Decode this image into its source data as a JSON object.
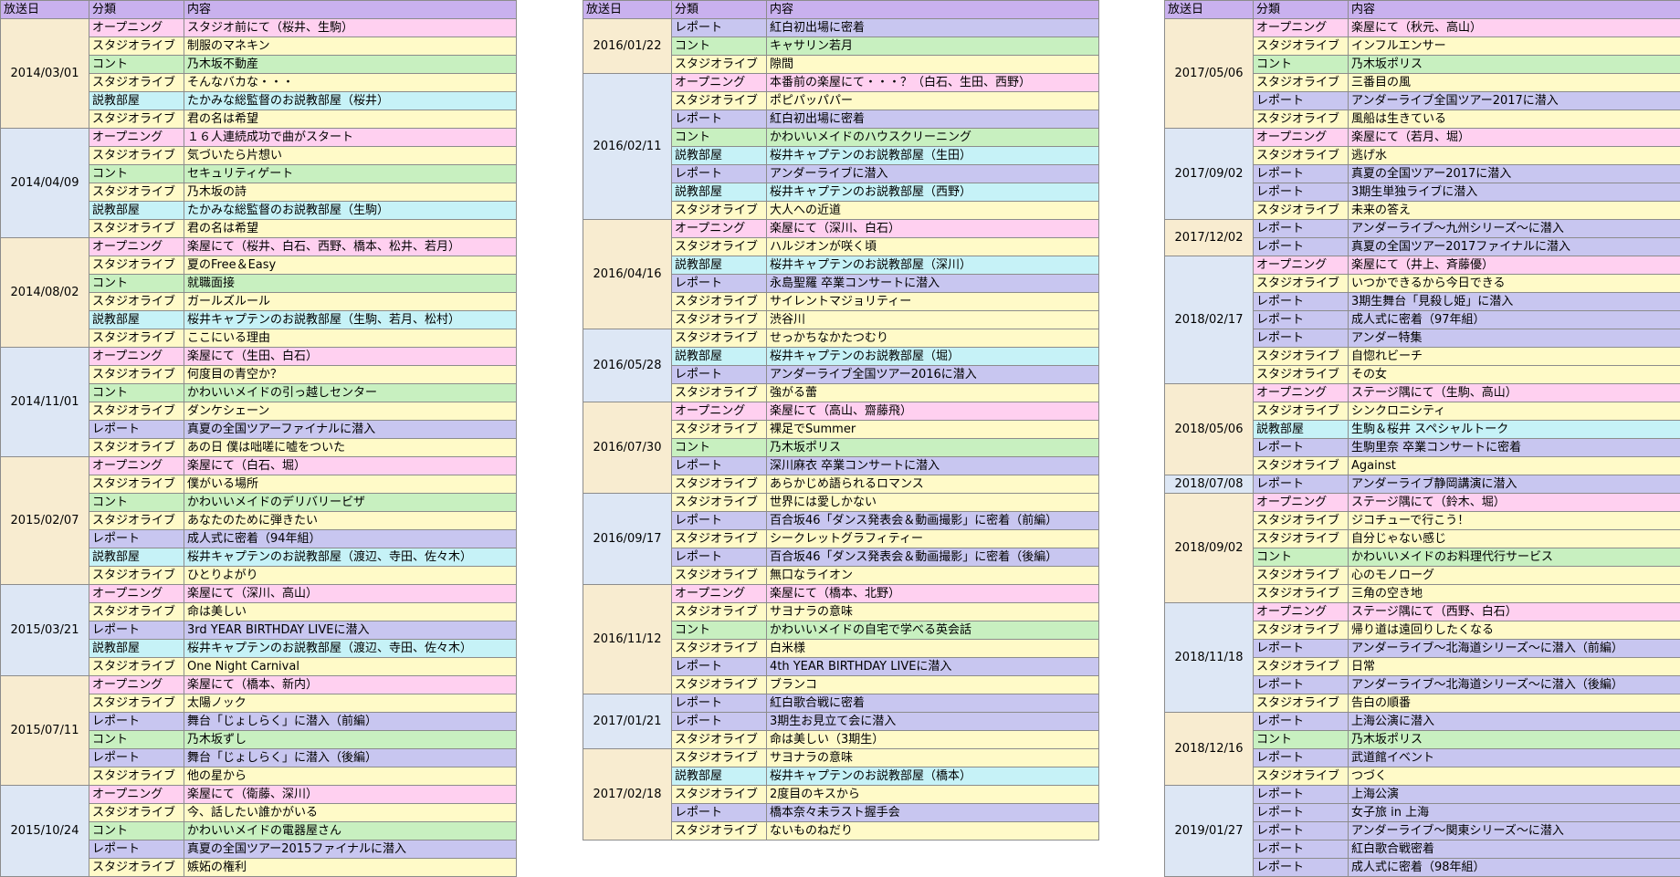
{
  "header": {
    "date": "放送日",
    "category": "分類",
    "content": "内容"
  },
  "colors": {
    "header": "#c9b1ee",
    "オープニング": "#ffd0f0",
    "スタジオライブ": "#fffac8",
    "コント": "#c8f0c0",
    "レポート": "#c8c6f0",
    "説教部屋": "#c6f2f7",
    "date_blue": "#dde7f5",
    "date_tan": "#f8ecd0"
  },
  "tables": [
    {
      "groups": [
        {
          "date": "2014/03/01",
          "rows": [
            {
              "cat": "オープニング",
              "text": "スタジオ前にて（桜井、生駒）"
            },
            {
              "cat": "スタジオライブ",
              "text": "制服のマネキン"
            },
            {
              "cat": "コント",
              "text": "乃木坂不動産"
            },
            {
              "cat": "スタジオライブ",
              "text": "そんなバカな・・・"
            },
            {
              "cat": "説教部屋",
              "text": "たかみな総監督のお説教部屋（桜井）"
            },
            {
              "cat": "スタジオライブ",
              "text": "君の名は希望"
            }
          ]
        },
        {
          "date": "2014/04/09",
          "rows": [
            {
              "cat": "オープニング",
              "text": "１６人連続成功で曲がスタート"
            },
            {
              "cat": "スタジオライブ",
              "text": "気づいたら片想い"
            },
            {
              "cat": "コント",
              "text": "セキュリティゲート"
            },
            {
              "cat": "スタジオライブ",
              "text": "乃木坂の詩"
            },
            {
              "cat": "説教部屋",
              "text": "たかみな総監督のお説教部屋（生駒）"
            },
            {
              "cat": "スタジオライブ",
              "text": "君の名は希望"
            }
          ]
        },
        {
          "date": "2014/08/02",
          "rows": [
            {
              "cat": "オープニング",
              "text": "楽屋にて（桜井、白石、西野、橋本、松井、若月）"
            },
            {
              "cat": "スタジオライブ",
              "text": "夏のFree＆Easy"
            },
            {
              "cat": "コント",
              "text": "就職面接"
            },
            {
              "cat": "スタジオライブ",
              "text": "ガールズルール"
            },
            {
              "cat": "説教部屋",
              "text": "桜井キャプテンのお説教部屋（生駒、若月、松村）"
            },
            {
              "cat": "スタジオライブ",
              "text": "ここにいる理由"
            }
          ]
        },
        {
          "date": "2014/11/01",
          "rows": [
            {
              "cat": "オープニング",
              "text": "楽屋にて（生田、白石）"
            },
            {
              "cat": "スタジオライブ",
              "text": "何度目の青空か？"
            },
            {
              "cat": "コント",
              "text": "かわいいメイドの引っ越しセンター"
            },
            {
              "cat": "スタジオライブ",
              "text": "ダンケシェーン"
            },
            {
              "cat": "レポート",
              "text": "真夏の全国ツアーファイナルに潜入"
            },
            {
              "cat": "スタジオライブ",
              "text": "あの日 僕は咄嗟に嘘をついた"
            }
          ]
        },
        {
          "date": "2015/02/07",
          "rows": [
            {
              "cat": "オープニング",
              "text": "楽屋にて（白石、堀）"
            },
            {
              "cat": "スタジオライブ",
              "text": "僕がいる場所"
            },
            {
              "cat": "コント",
              "text": "かわいいメイドのデリバリービザ"
            },
            {
              "cat": "スタジオライブ",
              "text": "あなたのために弾きたい"
            },
            {
              "cat": "レポート",
              "text": "成人式に密着（94年組）"
            },
            {
              "cat": "説教部屋",
              "text": "桜井キャプテンのお説教部屋（渡辺、寺田、佐々木）"
            },
            {
              "cat": "スタジオライブ",
              "text": "ひとりよがり"
            }
          ]
        },
        {
          "date": "2015/03/21",
          "rows": [
            {
              "cat": "オープニング",
              "text": "楽屋にて（深川、高山）"
            },
            {
              "cat": "スタジオライブ",
              "text": "命は美しい"
            },
            {
              "cat": "レポート",
              "text": "3rd YEAR BIRTHDAY LIVEに潜入"
            },
            {
              "cat": "説教部屋",
              "text": "桜井キャプテンのお説教部屋（渡辺、寺田、佐々木）"
            },
            {
              "cat": "スタジオライブ",
              "text": "One Night Carnival"
            }
          ]
        },
        {
          "date": "2015/07/11",
          "rows": [
            {
              "cat": "オープニング",
              "text": "楽屋にて（橋本、新内）"
            },
            {
              "cat": "スタジオライブ",
              "text": "太陽ノック"
            },
            {
              "cat": "レポート",
              "text": "舞台「じょしらく」に潜入（前編）"
            },
            {
              "cat": "コント",
              "text": "乃木坂ずし"
            },
            {
              "cat": "レポート",
              "text": "舞台「じょしらく」に潜入（後編）"
            },
            {
              "cat": "スタジオライブ",
              "text": "他の星から"
            }
          ]
        },
        {
          "date": "2015/10/24",
          "rows": [
            {
              "cat": "オープニング",
              "text": "楽屋にて（衛藤、深川）"
            },
            {
              "cat": "スタジオライブ",
              "text": "今、話したい誰かがいる"
            },
            {
              "cat": "コント",
              "text": "かわいいメイドの電器屋さん"
            },
            {
              "cat": "レポート",
              "text": "真夏の全国ツアー2015ファイナルに潜入"
            },
            {
              "cat": "スタジオライブ",
              "text": "嫉妬の権利"
            }
          ]
        }
      ]
    },
    {
      "groups": [
        {
          "date": "2016/01/22",
          "rows": [
            {
              "cat": "レポート",
              "text": "紅白初出場に密着"
            },
            {
              "cat": "コント",
              "text": "キャサリン若月"
            },
            {
              "cat": "スタジオライブ",
              "text": "隙間"
            }
          ]
        },
        {
          "date": "2016/02/11",
          "rows": [
            {
              "cat": "オープニング",
              "text": "本番前の楽屋にて・・・？（白石、生田、西野）"
            },
            {
              "cat": "スタジオライブ",
              "text": "ポピパッパパー"
            },
            {
              "cat": "レポート",
              "text": "紅白初出場に密着"
            },
            {
              "cat": "コント",
              "text": "かわいいメイドのハウスクリーニング"
            },
            {
              "cat": "説教部屋",
              "text": "桜井キャプテンのお説教部屋（生田）"
            },
            {
              "cat": "レポート",
              "text": "アンダーライブに潜入"
            },
            {
              "cat": "説教部屋",
              "text": "桜井キャプテンのお説教部屋（西野）"
            },
            {
              "cat": "スタジオライブ",
              "text": "大人への近道"
            }
          ]
        },
        {
          "date": "2016/04/16",
          "rows": [
            {
              "cat": "オープニング",
              "text": "楽屋にて（深川、白石）"
            },
            {
              "cat": "スタジオライブ",
              "text": "ハルジオンが咲く頃"
            },
            {
              "cat": "説教部屋",
              "text": "桜井キャプテンのお説教部屋（深川）"
            },
            {
              "cat": "レポート",
              "text": "永島聖羅 卒業コンサートに潜入"
            },
            {
              "cat": "スタジオライブ",
              "text": "サイレントマジョリティー"
            },
            {
              "cat": "スタジオライブ",
              "text": "渋谷川"
            }
          ]
        },
        {
          "date": "2016/05/28",
          "rows": [
            {
              "cat": "スタジオライブ",
              "text": "せっかちなかたつむり"
            },
            {
              "cat": "説教部屋",
              "text": "桜井キャプテンのお説教部屋（堀）"
            },
            {
              "cat": "レポート",
              "text": "アンダーライブ全国ツアー2016に潜入"
            },
            {
              "cat": "スタジオライブ",
              "text": "強がる蕾"
            }
          ]
        },
        {
          "date": "2016/07/30",
          "rows": [
            {
              "cat": "オープニング",
              "text": "楽屋にて（高山、齋藤飛）"
            },
            {
              "cat": "スタジオライブ",
              "text": "裸足でSummer"
            },
            {
              "cat": "コント",
              "text": "乃木坂ポリス"
            },
            {
              "cat": "レポート",
              "text": "深川麻衣 卒業コンサートに潜入"
            },
            {
              "cat": "スタジオライブ",
              "text": "あらかじめ語られるロマンス"
            }
          ]
        },
        {
          "date": "2016/09/17",
          "rows": [
            {
              "cat": "スタジオライブ",
              "text": "世界には愛しかない"
            },
            {
              "cat": "レポート",
              "text": "百合坂46「ダンス発表会＆動画撮影」に密着（前編）"
            },
            {
              "cat": "スタジオライブ",
              "text": "シークレットグラフィティー"
            },
            {
              "cat": "レポート",
              "text": "百合坂46「ダンス発表会＆動画撮影」に密着（後編）"
            },
            {
              "cat": "スタジオライブ",
              "text": "無口なライオン"
            }
          ]
        },
        {
          "date": "2016/11/12",
          "rows": [
            {
              "cat": "オープニング",
              "text": "楽屋にて（橋本、北野）"
            },
            {
              "cat": "スタジオライブ",
              "text": "サヨナラの意味"
            },
            {
              "cat": "コント",
              "text": "かわいいメイドの自宅で学べる英会話"
            },
            {
              "cat": "スタジオライブ",
              "text": "白米様"
            },
            {
              "cat": "レポート",
              "text": "4th YEAR BIRTHDAY LIVEに潜入"
            },
            {
              "cat": "スタジオライブ",
              "text": "ブランコ"
            }
          ]
        },
        {
          "date": "2017/01/21",
          "rows": [
            {
              "cat": "レポート",
              "text": "紅白歌合戦に密着"
            },
            {
              "cat": "レポート",
              "text": "3期生お見立て会に潜入"
            },
            {
              "cat": "スタジオライブ",
              "text": "命は美しい（3期生）"
            }
          ]
        },
        {
          "date": "2017/02/18",
          "rows": [
            {
              "cat": "スタジオライブ",
              "text": "サヨナラの意味"
            },
            {
              "cat": "説教部屋",
              "text": "桜井キャプテンのお説教部屋（橋本）"
            },
            {
              "cat": "スタジオライブ",
              "text": "2度目のキスから"
            },
            {
              "cat": "レポート",
              "text": "橋本奈々未ラスト握手会"
            },
            {
              "cat": "スタジオライブ",
              "text": "ないものねだり"
            }
          ]
        }
      ]
    },
    {
      "groups": [
        {
          "date": "2017/05/06",
          "rows": [
            {
              "cat": "オープニング",
              "text": "楽屋にて（秋元、高山）"
            },
            {
              "cat": "スタジオライブ",
              "text": "インフルエンサー"
            },
            {
              "cat": "コント",
              "text": "乃木坂ポリス"
            },
            {
              "cat": "スタジオライブ",
              "text": "三番目の風"
            },
            {
              "cat": "レポート",
              "text": "アンダーライブ全国ツアー2017に潜入"
            },
            {
              "cat": "スタジオライブ",
              "text": "風船は生きている"
            }
          ]
        },
        {
          "date": "2017/09/02",
          "rows": [
            {
              "cat": "オープニング",
              "text": "楽屋にて（若月、堀）"
            },
            {
              "cat": "スタジオライブ",
              "text": "逃げ水"
            },
            {
              "cat": "レポート",
              "text": "真夏の全国ツアー2017に潜入"
            },
            {
              "cat": "レポート",
              "text": "3期生単独ライブに潜入"
            },
            {
              "cat": "スタジオライブ",
              "text": "未来の答え"
            }
          ]
        },
        {
          "date": "2017/12/02",
          "rows": [
            {
              "cat": "レポート",
              "text": "アンダーライブ～九州シリーズ～に潜入"
            },
            {
              "cat": "レポート",
              "text": "真夏の全国ツアー2017ファイナルに潜入"
            }
          ]
        },
        {
          "date": "2018/02/17",
          "rows": [
            {
              "cat": "オープニング",
              "text": "楽屋にて（井上、斉藤優）"
            },
            {
              "cat": "スタジオライブ",
              "text": "いつかできるから今日できる"
            },
            {
              "cat": "レポート",
              "text": "3期生舞台「見殺し姫」に潜入"
            },
            {
              "cat": "レポート",
              "text": "成人式に密着（97年組）"
            },
            {
              "cat": "レポート",
              "text": "アンダー特集"
            },
            {
              "cat": "スタジオライブ",
              "text": "自惚れビーチ"
            },
            {
              "cat": "スタジオライブ",
              "text": "その女"
            }
          ]
        },
        {
          "date": "2018/05/06",
          "rows": [
            {
              "cat": "オープニング",
              "text": "ステージ隅にて（生駒、高山）"
            },
            {
              "cat": "スタジオライブ",
              "text": "シンクロニシティ"
            },
            {
              "cat": "説教部屋",
              "text": "生駒＆桜井 スペシャルトーク"
            },
            {
              "cat": "レポート",
              "text": "生駒里奈 卒業コンサートに密着"
            },
            {
              "cat": "スタジオライブ",
              "text": "Against"
            }
          ]
        },
        {
          "date": "2018/07/08",
          "rows": [
            {
              "cat": "レポート",
              "text": "アンダーライブ静岡講演に潜入"
            }
          ]
        },
        {
          "date": "2018/09/02",
          "rows": [
            {
              "cat": "オープニング",
              "text": "ステージ隅にて（鈴木、堀）"
            },
            {
              "cat": "スタジオライブ",
              "text": "ジコチューで行こう！"
            },
            {
              "cat": "スタジオライブ",
              "text": "自分じゃない感じ"
            },
            {
              "cat": "コント",
              "text": "かわいいメイドのお料理代行サービス"
            },
            {
              "cat": "スタジオライブ",
              "text": "心のモノローグ"
            },
            {
              "cat": "スタジオライブ",
              "text": "三角の空き地"
            }
          ]
        },
        {
          "date": "2018/11/18",
          "rows": [
            {
              "cat": "オープニング",
              "text": "ステージ隅にて（西野、白石）"
            },
            {
              "cat": "スタジオライブ",
              "text": "帰り道は遠回りしたくなる"
            },
            {
              "cat": "レポート",
              "text": "アンダーライブ～北海道シリーズ～に潜入（前編）"
            },
            {
              "cat": "スタジオライブ",
              "text": "日常"
            },
            {
              "cat": "レポート",
              "text": "アンダーライブ～北海道シリーズ～に潜入（後編）"
            },
            {
              "cat": "スタジオライブ",
              "text": "告白の順番"
            }
          ]
        },
        {
          "date": "2018/12/16",
          "rows": [
            {
              "cat": "レポート",
              "text": "上海公演に潜入"
            },
            {
              "cat": "コント",
              "text": "乃木坂ポリス"
            },
            {
              "cat": "レポート",
              "text": "武道館イベント"
            },
            {
              "cat": "スタジオライブ",
              "text": "つづく"
            }
          ]
        },
        {
          "date": "2019/01/27",
          "rows": [
            {
              "cat": "レポート",
              "text": "上海公演"
            },
            {
              "cat": "レポート",
              "text": "女子旅 in 上海"
            },
            {
              "cat": "レポート",
              "text": "アンダーライブ～関東シリーズ～に潜入"
            },
            {
              "cat": "レポート",
              "text": "紅白歌合戦密着"
            },
            {
              "cat": "レポート",
              "text": "成人式に密着（98年組）"
            }
          ]
        }
      ]
    }
  ]
}
